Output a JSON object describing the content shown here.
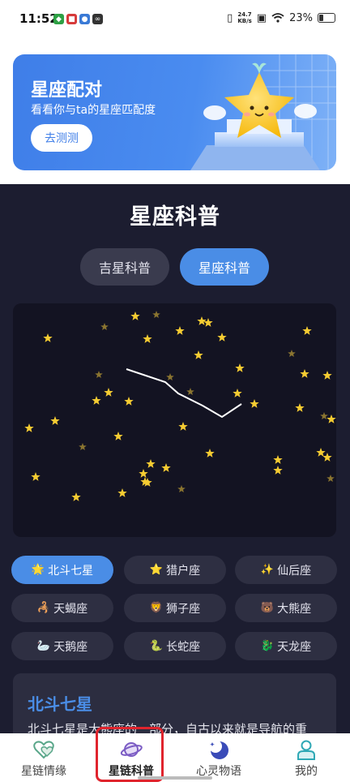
{
  "status_bar": {
    "time": "11:52",
    "net_speed_value": "24.7",
    "net_speed_unit": "KB/s",
    "battery": "23%",
    "battery_level": 0.23
  },
  "banner": {
    "title": "星座配对",
    "subtitle": "看看你与ta的星座匹配度",
    "button": "去测测"
  },
  "section_title": "星座科普",
  "tabs": [
    {
      "label": "吉星科普",
      "active": false
    },
    {
      "label": "星座科普",
      "active": true
    }
  ],
  "constellations": [
    {
      "icon": "🌟",
      "label": "北斗七星",
      "active": true
    },
    {
      "icon": "⭐",
      "label": "猎户座",
      "active": false
    },
    {
      "icon": "✨",
      "label": "仙后座",
      "active": false
    },
    {
      "icon": "🦂",
      "label": "天蝎座",
      "active": false
    },
    {
      "icon": "🦁",
      "label": "狮子座",
      "active": false
    },
    {
      "icon": "🐻",
      "label": "大熊座",
      "active": false
    },
    {
      "icon": "🦢",
      "label": "天鹅座",
      "active": false
    },
    {
      "icon": "🐍",
      "label": "长蛇座",
      "active": false
    },
    {
      "icon": "🐉",
      "label": "天龙座",
      "active": false
    }
  ],
  "detail": {
    "title": "北斗七星",
    "text": "北斗七星是大熊座的一部分，自古以来就是导航的重"
  },
  "bottom_nav": [
    {
      "label": "星链情缘",
      "icon": "hearts-icon",
      "active": false
    },
    {
      "label": "星链科普",
      "icon": "planet-icon",
      "active": true
    },
    {
      "label": "心灵物语",
      "icon": "moon-icon",
      "active": false
    },
    {
      "label": "我的",
      "icon": "person-icon",
      "active": false
    }
  ],
  "colors": {
    "accent": "#4a8de6",
    "background": "#1c1d30",
    "star_bright": "#f5cc32",
    "star_dim": "#8a7430",
    "highlight": "#e0242d"
  }
}
